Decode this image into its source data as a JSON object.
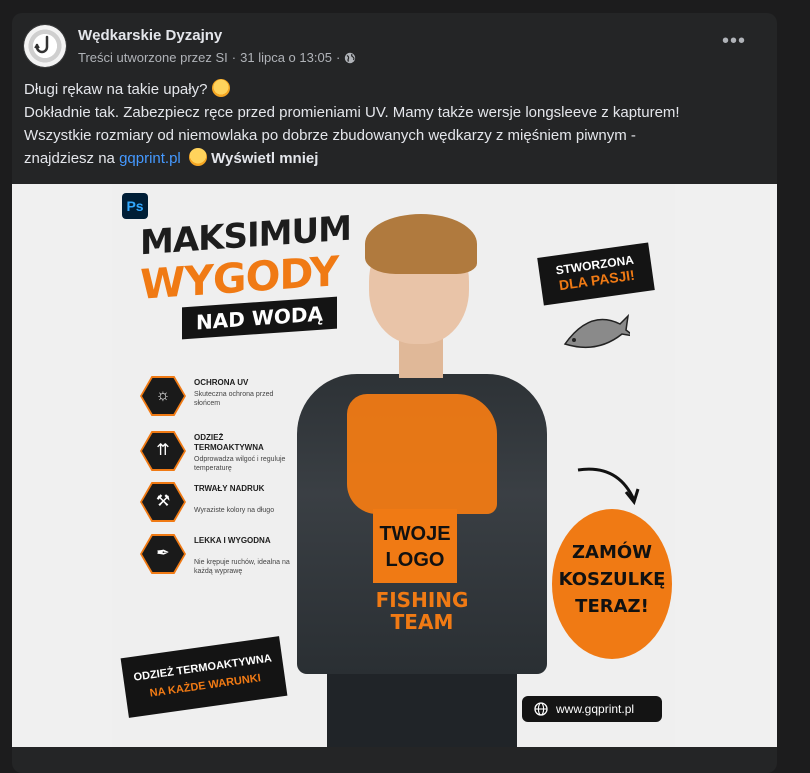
{
  "post": {
    "page_name": "Wędkarskie Dyzajny",
    "meta_author": "Treści utworzone przez SI",
    "meta_sep1": "·",
    "meta_time": "31 lipca o 13:05",
    "meta_sep2": "·",
    "more_label": "•••",
    "line1": "Długi rękaw na takie upały?",
    "line2": "Dokładnie tak. Zabezpiecz ręce przed promieniami UV. Mamy także wersje longsleeve z kapturem!",
    "line3": "Wszystkie rozmiary od niemowlaka po dobrze zbudowanych wędkarzy z mięśniem piwnym -",
    "line4_prefix": "znajdziesz na",
    "link": "gqprint.pl",
    "see_less": "Wyświetl mniej"
  },
  "ad": {
    "ps_badge": "Ps",
    "headline_1": "MAKSIMUM",
    "headline_2": "WYGODY",
    "headline_3": "NAD WODĄ",
    "features": [
      {
        "title": "OCHRONA UV",
        "desc": "Skuteczna ochrona przed słońcem",
        "icon": "uv-icon"
      },
      {
        "title": "ODZIEŻ TERMOAKTYWNA",
        "desc": "Odprowadza wilgoć i reguluje temperaturę",
        "icon": "thermo-icon"
      },
      {
        "title": "TRWAŁY NADRUK",
        "desc": "Wyraziste kolory na długo",
        "icon": "print-icon"
      },
      {
        "title": "LEKKA I WYGODNA",
        "desc": "Nie krępuje ruchów, idealna na każdą wyprawę",
        "icon": "feather-icon"
      }
    ],
    "stamp_line1": "STWORZONA",
    "stamp_line2": "DLA PASJI!",
    "logo_line1": "TWOJE",
    "logo_line2": "LOGO",
    "team_line1": "FISHING",
    "team_line2": "TEAM",
    "order_line1": "ZAMÓW",
    "order_line2": "KOSZULKĘ",
    "order_line3": "TERAZ!",
    "termo_line1": "ODZIEŻ TERMOAKTYWNA",
    "termo_line2": "NA KAŻDE WARUNKI",
    "url": "www.gqprint.pl"
  },
  "colors": {
    "background": "#1c1c1d",
    "card": "#242526",
    "link": "#4599ff",
    "accent_orange": "#f07a14"
  }
}
